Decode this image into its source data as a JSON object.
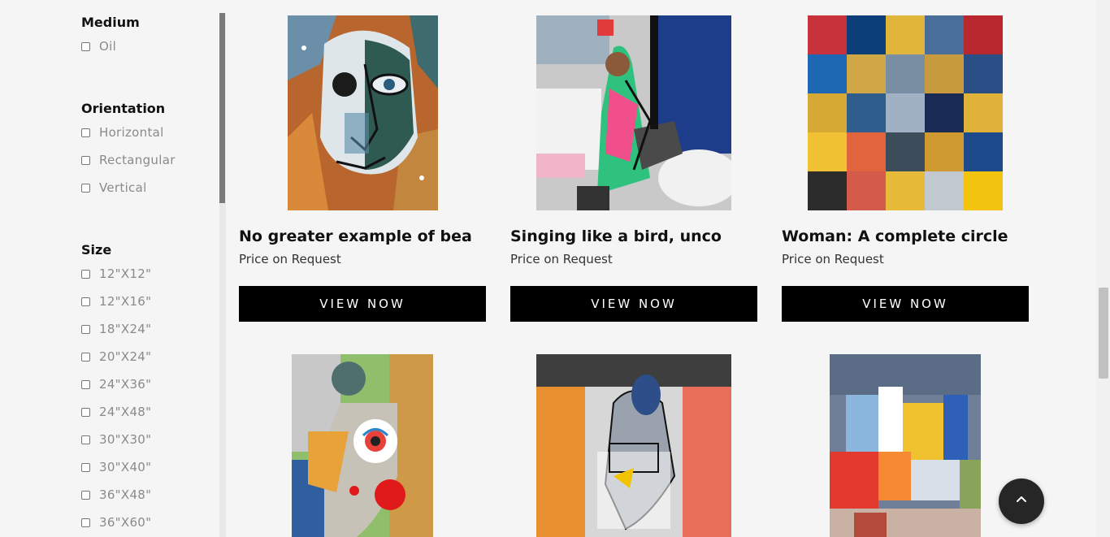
{
  "filters": {
    "medium": {
      "title": "Medium",
      "options": [
        "Oil"
      ]
    },
    "orientation": {
      "title": "Orientation",
      "options": [
        "Horizontal",
        "Rectangular",
        "Vertical"
      ]
    },
    "size": {
      "title": "Size",
      "options": [
        "12\"X12\"",
        "12\"X16\"",
        "18\"X24\"",
        "20\"X24\"",
        "24\"X36\"",
        "24\"X48\"",
        "30\"X30\"",
        "30\"X40\"",
        "36\"X48\"",
        "36\"X60\""
      ]
    }
  },
  "products": [
    {
      "title": "No greater example of bea",
      "price": "Price on Request",
      "button": "VIEW NOW"
    },
    {
      "title": "Singing like a bird, unco",
      "price": "Price on Request",
      "button": "VIEW NOW"
    },
    {
      "title": "Woman: A complete circle",
      "price": "Price on Request",
      "button": "VIEW NOW"
    }
  ],
  "icons": {
    "back_to_top": "chevron-up-icon"
  },
  "colors": {
    "button_bg": "#000000",
    "button_text": "#ffffff",
    "fab_bg": "#262626"
  }
}
